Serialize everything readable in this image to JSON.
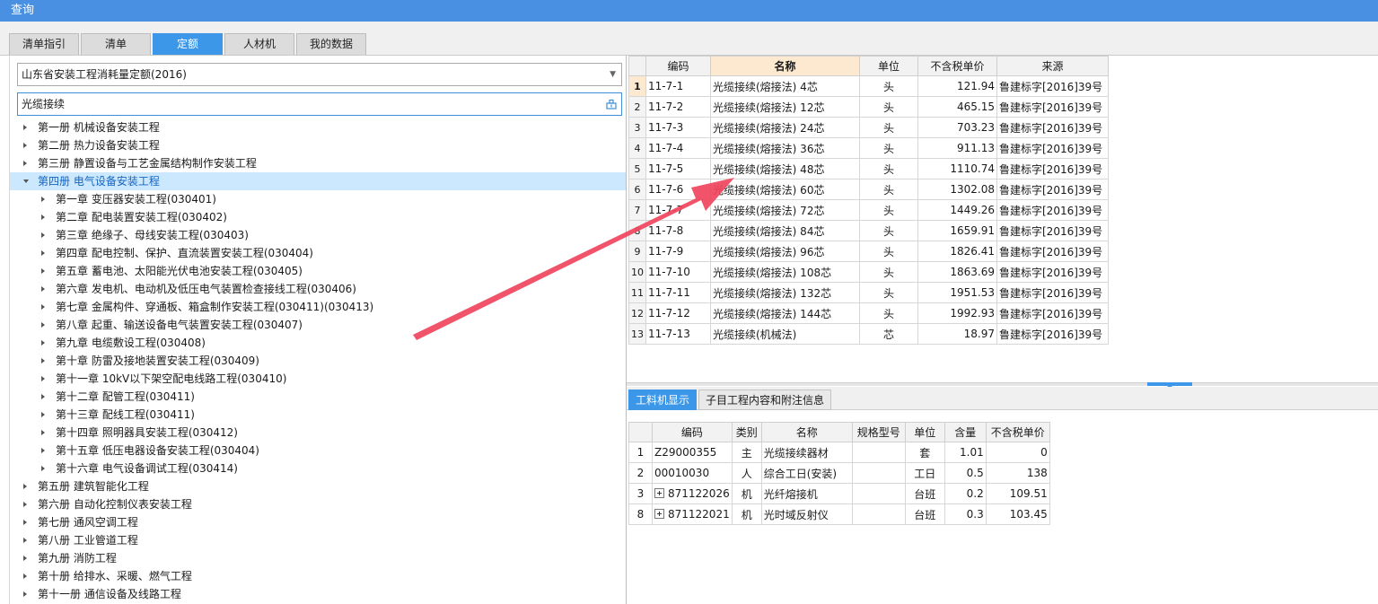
{
  "window": {
    "title": "查询"
  },
  "tabs": [
    {
      "label": "清单指引"
    },
    {
      "label": "清单"
    },
    {
      "label": "定额"
    },
    {
      "label": "人材机"
    },
    {
      "label": "我的数据"
    }
  ],
  "left": {
    "library": "山东省安装工程消耗量定额(2016)",
    "search_value": "光缆接续",
    "tree": [
      {
        "label": "第一册 机械设备安装工程",
        "level": 0,
        "expanded": false,
        "selected": false
      },
      {
        "label": "第二册 热力设备安装工程",
        "level": 0,
        "expanded": false,
        "selected": false
      },
      {
        "label": "第三册 静置设备与工艺金属结构制作安装工程",
        "level": 0,
        "expanded": false,
        "selected": false
      },
      {
        "label": "第四册 电气设备安装工程",
        "level": 0,
        "expanded": true,
        "selected": true
      },
      {
        "label": "第一章 变压器安装工程(030401)",
        "level": 1,
        "expanded": false,
        "selected": false
      },
      {
        "label": "第二章 配电装置安装工程(030402)",
        "level": 1,
        "expanded": false,
        "selected": false
      },
      {
        "label": "第三章 绝缘子、母线安装工程(030403)",
        "level": 1,
        "expanded": false,
        "selected": false
      },
      {
        "label": "第四章 配电控制、保护、直流装置安装工程(030404)",
        "level": 1,
        "expanded": false,
        "selected": false
      },
      {
        "label": "第五章 蓄电池、太阳能光伏电池安装工程(030405)",
        "level": 1,
        "expanded": false,
        "selected": false
      },
      {
        "label": "第六章 发电机、电动机及低压电气装置检查接线工程(030406)",
        "level": 1,
        "expanded": false,
        "selected": false
      },
      {
        "label": "第七章 金属构件、穿通板、箱盒制作安装工程(030411)(030413)",
        "level": 1,
        "expanded": false,
        "selected": false
      },
      {
        "label": "第八章 起重、输送设备电气装置安装工程(030407)",
        "level": 1,
        "expanded": false,
        "selected": false
      },
      {
        "label": "第九章 电缆敷设工程(030408)",
        "level": 1,
        "expanded": false,
        "selected": false
      },
      {
        "label": "第十章 防雷及接地装置安装工程(030409)",
        "level": 1,
        "expanded": false,
        "selected": false
      },
      {
        "label": "第十一章 10kV以下架空配电线路工程(030410)",
        "level": 1,
        "expanded": false,
        "selected": false
      },
      {
        "label": "第十二章 配管工程(030411)",
        "level": 1,
        "expanded": false,
        "selected": false
      },
      {
        "label": "第十三章 配线工程(030411)",
        "level": 1,
        "expanded": false,
        "selected": false
      },
      {
        "label": "第十四章 照明器具安装工程(030412)",
        "level": 1,
        "expanded": false,
        "selected": false
      },
      {
        "label": "第十五章 低压电器设备安装工程(030404)",
        "level": 1,
        "expanded": false,
        "selected": false
      },
      {
        "label": "第十六章 电气设备调试工程(030414)",
        "level": 1,
        "expanded": false,
        "selected": false
      },
      {
        "label": "第五册 建筑智能化工程",
        "level": 0,
        "expanded": false,
        "selected": false
      },
      {
        "label": "第六册 自动化控制仪表安装工程",
        "level": 0,
        "expanded": false,
        "selected": false
      },
      {
        "label": "第七册 通风空调工程",
        "level": 0,
        "expanded": false,
        "selected": false
      },
      {
        "label": "第八册 工业管道工程",
        "level": 0,
        "expanded": false,
        "selected": false
      },
      {
        "label": "第九册 消防工程",
        "level": 0,
        "expanded": false,
        "selected": false
      },
      {
        "label": "第十册 给排水、采暖、燃气工程",
        "level": 0,
        "expanded": false,
        "selected": false
      },
      {
        "label": "第十一册 通信设备及线路工程",
        "level": 0,
        "expanded": false,
        "selected": false
      }
    ]
  },
  "quota_table": {
    "headers": [
      "编码",
      "名称",
      "单位",
      "不含税单价",
      "来源"
    ],
    "rows": [
      {
        "n": "1",
        "code": "11-7-1",
        "name": "光缆接续(熔接法) 4芯",
        "unit": "头",
        "price": "121.94",
        "source": "鲁建标字[2016]39号"
      },
      {
        "n": "2",
        "code": "11-7-2",
        "name": "光缆接续(熔接法) 12芯",
        "unit": "头",
        "price": "465.15",
        "source": "鲁建标字[2016]39号"
      },
      {
        "n": "3",
        "code": "11-7-3",
        "name": "光缆接续(熔接法) 24芯",
        "unit": "头",
        "price": "703.23",
        "source": "鲁建标字[2016]39号"
      },
      {
        "n": "4",
        "code": "11-7-4",
        "name": "光缆接续(熔接法) 36芯",
        "unit": "头",
        "price": "911.13",
        "source": "鲁建标字[2016]39号"
      },
      {
        "n": "5",
        "code": "11-7-5",
        "name": "光缆接续(熔接法) 48芯",
        "unit": "头",
        "price": "1110.74",
        "source": "鲁建标字[2016]39号"
      },
      {
        "n": "6",
        "code": "11-7-6",
        "name": "光缆接续(熔接法) 60芯",
        "unit": "头",
        "price": "1302.08",
        "source": "鲁建标字[2016]39号"
      },
      {
        "n": "7",
        "code": "11-7-7",
        "name": "光缆接续(熔接法) 72芯",
        "unit": "头",
        "price": "1449.26",
        "source": "鲁建标字[2016]39号"
      },
      {
        "n": "8",
        "code": "11-7-8",
        "name": "光缆接续(熔接法) 84芯",
        "unit": "头",
        "price": "1659.91",
        "source": "鲁建标字[2016]39号"
      },
      {
        "n": "9",
        "code": "11-7-9",
        "name": "光缆接续(熔接法) 96芯",
        "unit": "头",
        "price": "1826.41",
        "source": "鲁建标字[2016]39号"
      },
      {
        "n": "10",
        "code": "11-7-10",
        "name": "光缆接续(熔接法) 108芯",
        "unit": "头",
        "price": "1863.69",
        "source": "鲁建标字[2016]39号"
      },
      {
        "n": "11",
        "code": "11-7-11",
        "name": "光缆接续(熔接法) 132芯",
        "unit": "头",
        "price": "1951.53",
        "source": "鲁建标字[2016]39号"
      },
      {
        "n": "12",
        "code": "11-7-12",
        "name": "光缆接续(熔接法) 144芯",
        "unit": "头",
        "price": "1992.93",
        "source": "鲁建标字[2016]39号"
      },
      {
        "n": "13",
        "code": "11-7-13",
        "name": "光缆接续(机械法)",
        "unit": "芯",
        "price": "18.97",
        "source": "鲁建标字[2016]39号"
      }
    ]
  },
  "bottom_tabs": [
    {
      "label": "工料机显示"
    },
    {
      "label": "子目工程内容和附注信息"
    }
  ],
  "material_table": {
    "headers": [
      "编码",
      "类别",
      "名称",
      "规格型号",
      "单位",
      "含量",
      "不含税单价"
    ],
    "rows": [
      {
        "n": "1",
        "code": "Z29000355",
        "type": "主",
        "name": "光缆接续器材",
        "spec": "",
        "unit": "套",
        "qty": "1.01",
        "price": "0",
        "expandable": false
      },
      {
        "n": "2",
        "code": "00010030",
        "type": "人",
        "name": "综合工日(安装)",
        "spec": "",
        "unit": "工日",
        "qty": "0.5",
        "price": "138",
        "expandable": false
      },
      {
        "n": "3",
        "code": "871122026",
        "type": "机",
        "name": "光纤熔接机",
        "spec": "",
        "unit": "台班",
        "qty": "0.2",
        "price": "109.51",
        "expandable": true
      },
      {
        "n": "8",
        "code": "871122021",
        "type": "机",
        "name": "光时域反射仪",
        "spec": "",
        "unit": "台班",
        "qty": "0.3",
        "price": "103.45",
        "expandable": true
      }
    ]
  },
  "colors": {
    "accent": "#3c97e8",
    "title_bar": "#4a90e2",
    "selected_row": "#cce8ff",
    "highlight_header": "#fde9cf",
    "annotation_arrow": "#f0445d"
  }
}
